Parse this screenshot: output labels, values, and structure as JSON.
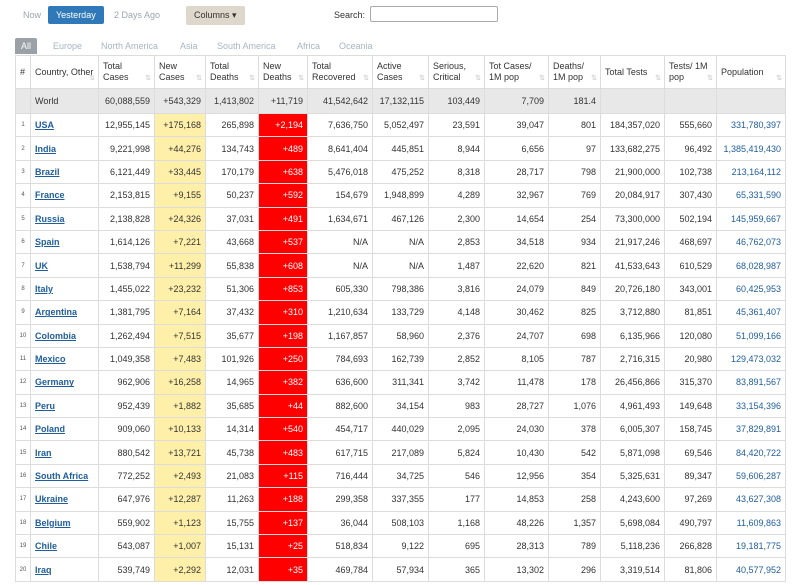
{
  "toolbar": {
    "now": "Now",
    "yesterday": "Yesterday",
    "two_days_ago": "2 Days Ago",
    "columns": "Columns",
    "columns_caret": "▾",
    "search_label": "Search:",
    "search_value": ""
  },
  "tabs": [
    "All",
    "Europe",
    "North America",
    "Asia",
    "South America",
    "Africa",
    "Oceania"
  ],
  "columns": [
    {
      "label": "#",
      "sort": false
    },
    {
      "label": "Country, Other",
      "sort": true
    },
    {
      "label": "Total Cases",
      "sort": true
    },
    {
      "label": "New Cases",
      "sort": true
    },
    {
      "label": "Total Deaths",
      "sort": true
    },
    {
      "label": "New Deaths",
      "sort": true
    },
    {
      "label": "Total Recovered",
      "sort": true
    },
    {
      "label": "Active Cases",
      "sort": true
    },
    {
      "label": "Serious, Critical",
      "sort": true
    },
    {
      "label": "Tot Cases/ 1M pop",
      "sort": true
    },
    {
      "label": "Deaths/ 1M pop",
      "sort": true
    },
    {
      "label": "Total Tests",
      "sort": true
    },
    {
      "label": "Tests/ 1M pop",
      "sort": true
    },
    {
      "label": "Population",
      "sort": true
    }
  ],
  "world": {
    "country": "World",
    "total_cases": "60,088,559",
    "new_cases": "+543,329",
    "total_deaths": "1,413,802",
    "new_deaths": "+11,719",
    "total_recovered": "41,542,642",
    "active_cases": "17,132,115",
    "serious": "103,449",
    "cases_1m": "7,709",
    "deaths_1m": "181.4",
    "total_tests": "",
    "tests_1m": "",
    "population": ""
  },
  "rows": [
    {
      "n": "1",
      "country": "USA",
      "total_cases": "12,955,145",
      "new_cases": "+175,168",
      "total_deaths": "265,898",
      "new_deaths": "+2,194",
      "total_recovered": "7,636,750",
      "active_cases": "5,052,497",
      "serious": "23,591",
      "cases_1m": "39,047",
      "deaths_1m": "801",
      "total_tests": "184,357,020",
      "tests_1m": "555,660",
      "population": "331,780,397"
    },
    {
      "n": "2",
      "country": "India",
      "total_cases": "9,221,998",
      "new_cases": "+44,276",
      "total_deaths": "134,743",
      "new_deaths": "+489",
      "total_recovered": "8,641,404",
      "active_cases": "445,851",
      "serious": "8,944",
      "cases_1m": "6,656",
      "deaths_1m": "97",
      "total_tests": "133,682,275",
      "tests_1m": "96,492",
      "population": "1,385,419,430"
    },
    {
      "n": "3",
      "country": "Brazil",
      "total_cases": "6,121,449",
      "new_cases": "+33,445",
      "total_deaths": "170,179",
      "new_deaths": "+638",
      "total_recovered": "5,476,018",
      "active_cases": "475,252",
      "serious": "8,318",
      "cases_1m": "28,717",
      "deaths_1m": "798",
      "total_tests": "21,900,000",
      "tests_1m": "102,738",
      "population": "213,164,112"
    },
    {
      "n": "4",
      "country": "France",
      "total_cases": "2,153,815",
      "new_cases": "+9,155",
      "total_deaths": "50,237",
      "new_deaths": "+592",
      "total_recovered": "154,679",
      "active_cases": "1,948,899",
      "serious": "4,289",
      "cases_1m": "32,967",
      "deaths_1m": "769",
      "total_tests": "20,084,917",
      "tests_1m": "307,430",
      "population": "65,331,590"
    },
    {
      "n": "5",
      "country": "Russia",
      "total_cases": "2,138,828",
      "new_cases": "+24,326",
      "total_deaths": "37,031",
      "new_deaths": "+491",
      "total_recovered": "1,634,671",
      "active_cases": "467,126",
      "serious": "2,300",
      "cases_1m": "14,654",
      "deaths_1m": "254",
      "total_tests": "73,300,000",
      "tests_1m": "502,194",
      "population": "145,959,667"
    },
    {
      "n": "6",
      "country": "Spain",
      "total_cases": "1,614,126",
      "new_cases": "+7,221",
      "total_deaths": "43,668",
      "new_deaths": "+537",
      "total_recovered": "N/A",
      "active_cases": "N/A",
      "serious": "2,853",
      "cases_1m": "34,518",
      "deaths_1m": "934",
      "total_tests": "21,917,246",
      "tests_1m": "468,697",
      "population": "46,762,073"
    },
    {
      "n": "7",
      "country": "UK",
      "total_cases": "1,538,794",
      "new_cases": "+11,299",
      "total_deaths": "55,838",
      "new_deaths": "+608",
      "total_recovered": "N/A",
      "active_cases": "N/A",
      "serious": "1,487",
      "cases_1m": "22,620",
      "deaths_1m": "821",
      "total_tests": "41,533,643",
      "tests_1m": "610,529",
      "population": "68,028,987"
    },
    {
      "n": "8",
      "country": "Italy",
      "total_cases": "1,455,022",
      "new_cases": "+23,232",
      "total_deaths": "51,306",
      "new_deaths": "+853",
      "total_recovered": "605,330",
      "active_cases": "798,386",
      "serious": "3,816",
      "cases_1m": "24,079",
      "deaths_1m": "849",
      "total_tests": "20,726,180",
      "tests_1m": "343,001",
      "population": "60,425,953"
    },
    {
      "n": "9",
      "country": "Argentina",
      "total_cases": "1,381,795",
      "new_cases": "+7,164",
      "total_deaths": "37,432",
      "new_deaths": "+310",
      "total_recovered": "1,210,634",
      "active_cases": "133,729",
      "serious": "4,148",
      "cases_1m": "30,462",
      "deaths_1m": "825",
      "total_tests": "3,712,880",
      "tests_1m": "81,851",
      "population": "45,361,407"
    },
    {
      "n": "10",
      "country": "Colombia",
      "total_cases": "1,262,494",
      "new_cases": "+7,515",
      "total_deaths": "35,677",
      "new_deaths": "+198",
      "total_recovered": "1,167,857",
      "active_cases": "58,960",
      "serious": "2,376",
      "cases_1m": "24,707",
      "deaths_1m": "698",
      "total_tests": "6,135,966",
      "tests_1m": "120,080",
      "population": "51,099,166"
    },
    {
      "n": "11",
      "country": "Mexico",
      "total_cases": "1,049,358",
      "new_cases": "+7,483",
      "total_deaths": "101,926",
      "new_deaths": "+250",
      "total_recovered": "784,693",
      "active_cases": "162,739",
      "serious": "2,852",
      "cases_1m": "8,105",
      "deaths_1m": "787",
      "total_tests": "2,716,315",
      "tests_1m": "20,980",
      "population": "129,473,032"
    },
    {
      "n": "12",
      "country": "Germany",
      "total_cases": "962,906",
      "new_cases": "+16,258",
      "total_deaths": "14,965",
      "new_deaths": "+382",
      "total_recovered": "636,600",
      "active_cases": "311,341",
      "serious": "3,742",
      "cases_1m": "11,478",
      "deaths_1m": "178",
      "total_tests": "26,456,866",
      "tests_1m": "315,370",
      "population": "83,891,567"
    },
    {
      "n": "13",
      "country": "Peru",
      "total_cases": "952,439",
      "new_cases": "+1,882",
      "total_deaths": "35,685",
      "new_deaths": "+44",
      "total_recovered": "882,600",
      "active_cases": "34,154",
      "serious": "983",
      "cases_1m": "28,727",
      "deaths_1m": "1,076",
      "total_tests": "4,961,493",
      "tests_1m": "149,648",
      "population": "33,154,396"
    },
    {
      "n": "14",
      "country": "Poland",
      "total_cases": "909,060",
      "new_cases": "+10,133",
      "total_deaths": "14,314",
      "new_deaths": "+540",
      "total_recovered": "454,717",
      "active_cases": "440,029",
      "serious": "2,095",
      "cases_1m": "24,030",
      "deaths_1m": "378",
      "total_tests": "6,005,307",
      "tests_1m": "158,745",
      "population": "37,829,891"
    },
    {
      "n": "15",
      "country": "Iran",
      "total_cases": "880,542",
      "new_cases": "+13,721",
      "total_deaths": "45,738",
      "new_deaths": "+483",
      "total_recovered": "617,715",
      "active_cases": "217,089",
      "serious": "5,824",
      "cases_1m": "10,430",
      "deaths_1m": "542",
      "total_tests": "5,871,098",
      "tests_1m": "69,546",
      "population": "84,420,722"
    },
    {
      "n": "16",
      "country": "South Africa",
      "total_cases": "772,252",
      "new_cases": "+2,493",
      "total_deaths": "21,083",
      "new_deaths": "+115",
      "total_recovered": "716,444",
      "active_cases": "34,725",
      "serious": "546",
      "cases_1m": "12,956",
      "deaths_1m": "354",
      "total_tests": "5,325,631",
      "tests_1m": "89,347",
      "population": "59,606,287"
    },
    {
      "n": "17",
      "country": "Ukraine",
      "total_cases": "647,976",
      "new_cases": "+12,287",
      "total_deaths": "11,263",
      "new_deaths": "+188",
      "total_recovered": "299,358",
      "active_cases": "337,355",
      "serious": "177",
      "cases_1m": "14,853",
      "deaths_1m": "258",
      "total_tests": "4,243,600",
      "tests_1m": "97,269",
      "population": "43,627,308"
    },
    {
      "n": "18",
      "country": "Belgium",
      "total_cases": "559,902",
      "new_cases": "+1,123",
      "total_deaths": "15,755",
      "new_deaths": "+137",
      "total_recovered": "36,044",
      "active_cases": "508,103",
      "serious": "1,168",
      "cases_1m": "48,226",
      "deaths_1m": "1,357",
      "total_tests": "5,698,084",
      "tests_1m": "490,797",
      "population": "11,609,863"
    },
    {
      "n": "19",
      "country": "Chile",
      "total_cases": "543,087",
      "new_cases": "+1,007",
      "total_deaths": "15,131",
      "new_deaths": "+25",
      "total_recovered": "518,834",
      "active_cases": "9,122",
      "serious": "695",
      "cases_1m": "28,313",
      "deaths_1m": "789",
      "total_tests": "5,118,236",
      "tests_1m": "266,828",
      "population": "19,181,775"
    },
    {
      "n": "20",
      "country": "Iraq",
      "total_cases": "539,749",
      "new_cases": "+2,292",
      "total_deaths": "12,031",
      "new_deaths": "+35",
      "total_recovered": "469,784",
      "active_cases": "57,934",
      "serious": "365",
      "cases_1m": "13,302",
      "deaths_1m": "296",
      "total_tests": "3,319,514",
      "tests_1m": "81,806",
      "population": "40,577,952"
    }
  ],
  "colors": {
    "new_cases_bg": "#fff0a9",
    "new_deaths_bg": "#ff0000",
    "link": "#1f5d9c",
    "active_button": "#2f79b8"
  },
  "icons": {
    "sort": "sort-arrows-icon"
  }
}
